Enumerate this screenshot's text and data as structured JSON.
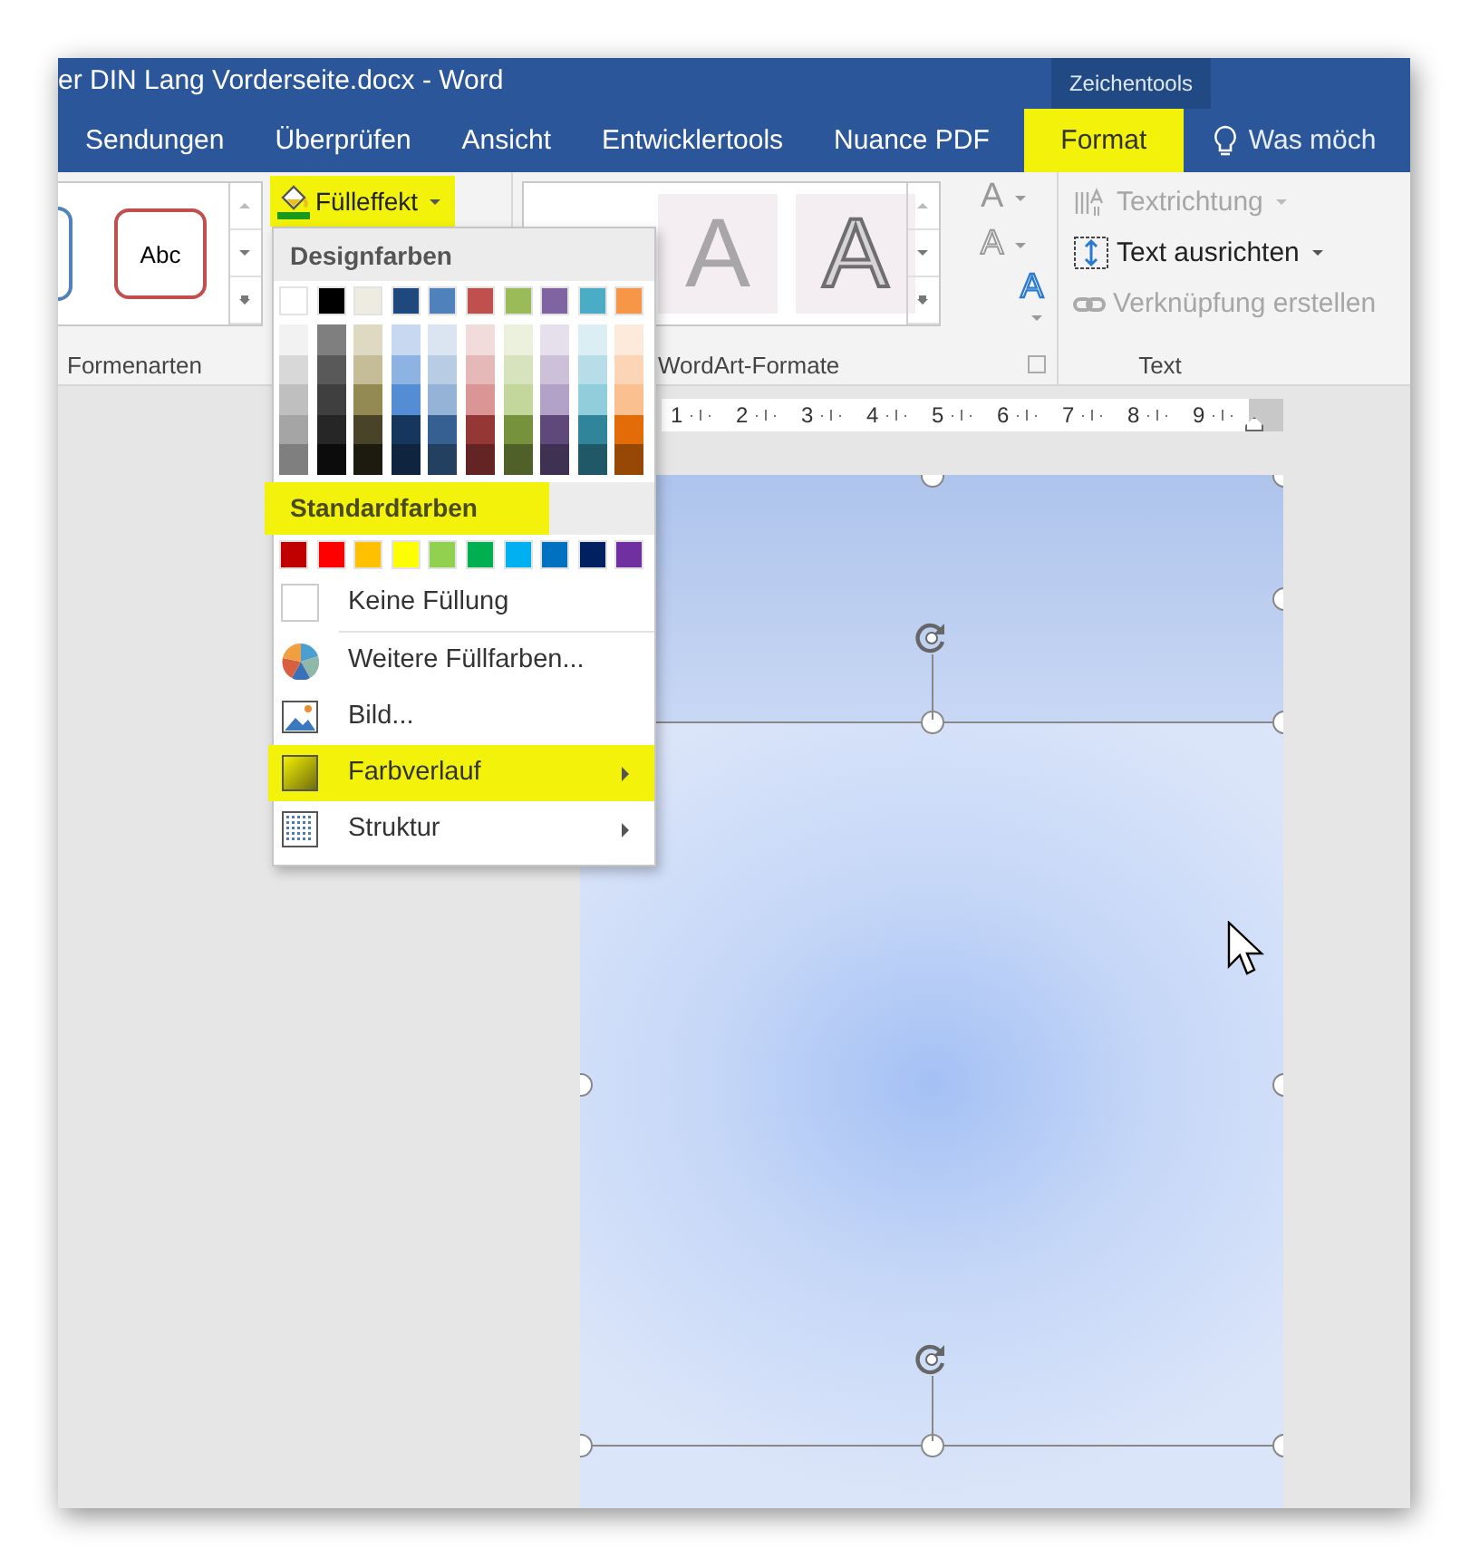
{
  "window": {
    "title": "er DIN Lang Vorderseite.docx - Word",
    "context_label": "Zeichentools"
  },
  "tabs": [
    {
      "label": "Sendungen",
      "selected": false,
      "highlighted": false
    },
    {
      "label": "Überprüfen",
      "selected": false,
      "highlighted": false
    },
    {
      "label": "Ansicht",
      "selected": false,
      "highlighted": false
    },
    {
      "label": "Entwicklertools",
      "selected": false,
      "highlighted": false
    },
    {
      "label": "Nuance PDF",
      "selected": false,
      "highlighted": false
    },
    {
      "label": "Format",
      "selected": true,
      "highlighted": true
    }
  ],
  "tell_me": {
    "label": "Was möch"
  },
  "ribbon": {
    "shape_styles": {
      "label": "Formenarten",
      "sample": "Abc"
    },
    "fill_button": {
      "label": "Fülleffekt",
      "highlighted": true
    },
    "wordart": {
      "label": "WordArt-Formate",
      "samples": [
        {
          "text": "A",
          "kind": "flat"
        },
        {
          "text": "A",
          "kind": "outline"
        }
      ],
      "effect_buttons": [
        {
          "text": "A",
          "kind": "fill"
        },
        {
          "text": "A",
          "kind": "outline"
        },
        {
          "text": "A",
          "kind": "effects"
        }
      ]
    },
    "text_group": {
      "label": "Text",
      "commands": [
        {
          "label": "Textrichtung",
          "kind": "direction",
          "disabled": true,
          "dropdown": true
        },
        {
          "label": "Text ausrichten",
          "kind": "align",
          "disabled": false,
          "dropdown": true
        },
        {
          "label": "Verknüpfung erstellen",
          "kind": "link",
          "disabled": true,
          "dropdown": false
        }
      ]
    }
  },
  "ruler": {
    "numbers": [
      "1",
      "2",
      "3",
      "4",
      "5",
      "6",
      "7",
      "8",
      "9"
    ]
  },
  "fill_menu": {
    "theme_heading": {
      "text": "Designfarben",
      "highlighted": false
    },
    "theme_colors": [
      {
        "color": "#ffffff",
        "shades": [
          {
            "color": "#f2f2f2"
          },
          {
            "color": "#d8d8d8"
          },
          {
            "color": "#bfbfbf"
          },
          {
            "color": "#a5a5a5"
          },
          {
            "color": "#7f7f7f"
          }
        ]
      },
      {
        "color": "#000000",
        "shades": [
          {
            "color": "#7f7f7f"
          },
          {
            "color": "#595959"
          },
          {
            "color": "#3f3f3f"
          },
          {
            "color": "#262626"
          },
          {
            "color": "#0c0c0c"
          }
        ]
      },
      {
        "color": "#eeece1",
        "shades": [
          {
            "color": "#ddd9c3"
          },
          {
            "color": "#c4bd97"
          },
          {
            "color": "#938953"
          },
          {
            "color": "#494429"
          },
          {
            "color": "#1d1b10"
          }
        ]
      },
      {
        "color": "#1f497d",
        "shades": [
          {
            "color": "#c6d9f0"
          },
          {
            "color": "#8db3e2"
          },
          {
            "color": "#548dd4"
          },
          {
            "color": "#17365d"
          },
          {
            "color": "#0f243e"
          }
        ]
      },
      {
        "color": "#4f81bd",
        "shades": [
          {
            "color": "#dbe5f1"
          },
          {
            "color": "#b8cce4"
          },
          {
            "color": "#95b3d7"
          },
          {
            "color": "#366092"
          },
          {
            "color": "#244061"
          }
        ]
      },
      {
        "color": "#c0504d",
        "shades": [
          {
            "color": "#f2dcdb"
          },
          {
            "color": "#e5b9b7"
          },
          {
            "color": "#d99694"
          },
          {
            "color": "#953734"
          },
          {
            "color": "#632423"
          }
        ]
      },
      {
        "color": "#9bbb59",
        "shades": [
          {
            "color": "#ebf1dd"
          },
          {
            "color": "#d7e3bc"
          },
          {
            "color": "#c3d69b"
          },
          {
            "color": "#76923c"
          },
          {
            "color": "#4f6128"
          }
        ]
      },
      {
        "color": "#8064a2",
        "shades": [
          {
            "color": "#e5e0ec"
          },
          {
            "color": "#ccc1d9"
          },
          {
            "color": "#b2a2c7"
          },
          {
            "color": "#5f497a"
          },
          {
            "color": "#3f3151"
          }
        ]
      },
      {
        "color": "#4bacc6",
        "shades": [
          {
            "color": "#dbeef3"
          },
          {
            "color": "#b7dde8"
          },
          {
            "color": "#92cddc"
          },
          {
            "color": "#31859b"
          },
          {
            "color": "#205867"
          }
        ]
      },
      {
        "color": "#f79646",
        "shades": [
          {
            "color": "#fdeada"
          },
          {
            "color": "#fbd5b5"
          },
          {
            "color": "#fac08f"
          },
          {
            "color": "#e36c09"
          },
          {
            "color": "#974806"
          }
        ]
      }
    ],
    "standard_heading": {
      "text": "Standardfarben",
      "highlighted": true
    },
    "standard_colors": [
      {
        "color": "#c00000"
      },
      {
        "color": "#ff0000"
      },
      {
        "color": "#ffc000"
      },
      {
        "color": "#ffff00"
      },
      {
        "color": "#92d050"
      },
      {
        "color": "#00b050"
      },
      {
        "color": "#00b0f0"
      },
      {
        "color": "#0070c0"
      },
      {
        "color": "#002060"
      },
      {
        "color": "#7030a0"
      }
    ],
    "items": [
      {
        "label": "Keine Füllung",
        "kind": "none",
        "submenu": false,
        "highlighted": false
      },
      {
        "label": "Weitere Füllfarben...",
        "kind": "more",
        "submenu": false,
        "highlighted": false
      },
      {
        "label": "Bild...",
        "kind": "picture",
        "submenu": false,
        "highlighted": false
      },
      {
        "label": "Farbverlauf",
        "kind": "gradient",
        "submenu": true,
        "highlighted": true
      },
      {
        "label": "Struktur",
        "kind": "texture",
        "submenu": true,
        "highlighted": false
      }
    ]
  }
}
